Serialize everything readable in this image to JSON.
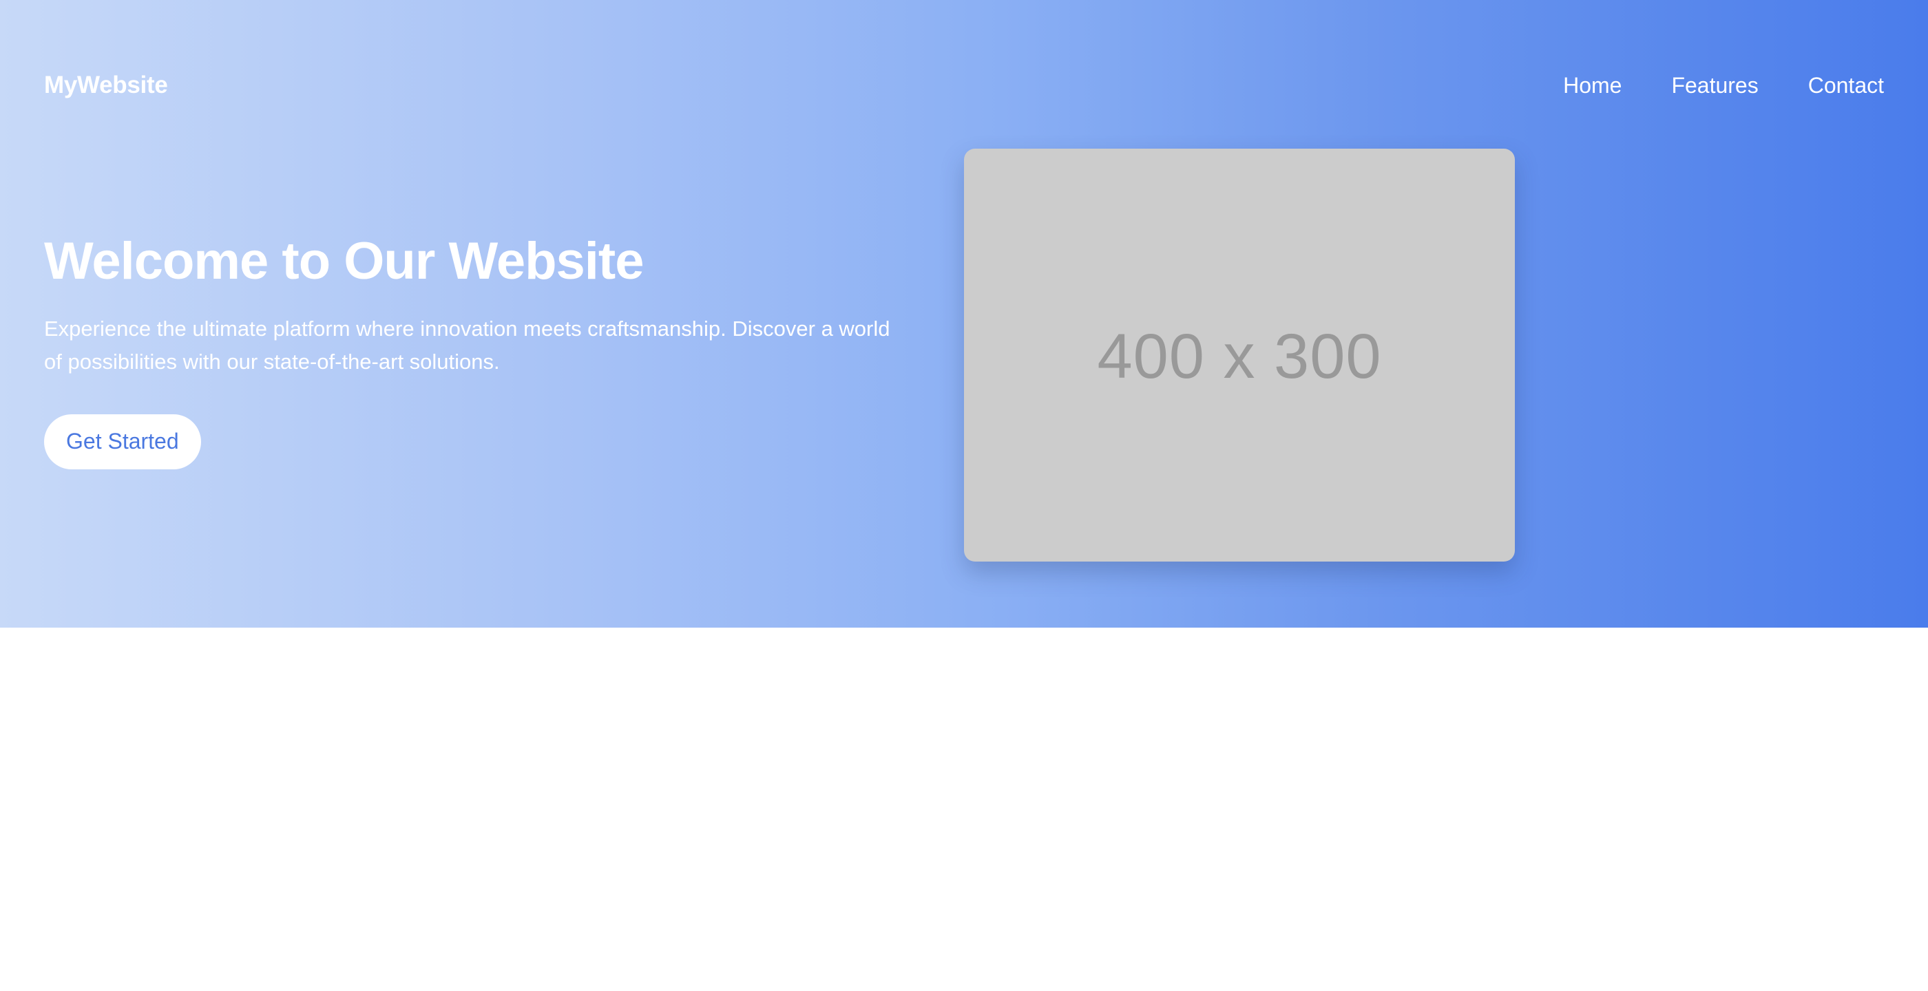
{
  "header": {
    "logo_text": "MyWebsite",
    "nav": [
      {
        "label": "Home"
      },
      {
        "label": "Features"
      },
      {
        "label": "Contact"
      }
    ]
  },
  "hero": {
    "title": "Welcome to Our Website",
    "subtitle": "Experience the ultimate platform where innovation meets craftsmanship. Discover a world of possibilities with our state-of-the-art solutions.",
    "cta_label": "Get Started",
    "image_placeholder": "400 x 300"
  },
  "colors": {
    "gradient_start": "#c7d9f8",
    "gradient_end": "#4a7ceb",
    "button_text": "#4a78e0",
    "image_bg": "#cccccc",
    "image_text": "#999999"
  }
}
